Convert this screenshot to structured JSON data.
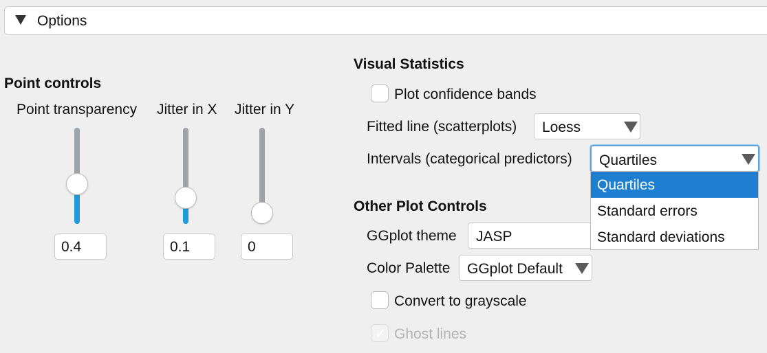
{
  "options": {
    "label": "Options"
  },
  "point_controls": {
    "title": "Point controls",
    "sliders": [
      {
        "label": "Point transparency",
        "value": "0.4"
      },
      {
        "label": "Jitter in X",
        "value": "0.1"
      },
      {
        "label": "Jitter in Y",
        "value": "0"
      }
    ]
  },
  "visual_statistics": {
    "title": "Visual Statistics",
    "confidence_bands": {
      "label": "Plot confidence bands",
      "checked": false
    },
    "fitted_line": {
      "label": "Fitted line (scatterplots)",
      "value": "Loess"
    },
    "intervals": {
      "label": "Intervals (categorical predictors)",
      "value": "Quartiles",
      "options": [
        "Quartiles",
        "Standard errors",
        "Standard deviations"
      ],
      "selected_index": 0
    }
  },
  "other_plot_controls": {
    "title": "Other Plot Controls",
    "ggplot_theme": {
      "label": "GGplot theme",
      "value": "JASP"
    },
    "color_palette": {
      "label": "Color Palette",
      "value": "GGplot Default"
    },
    "grayscale": {
      "label": "Convert to grayscale",
      "checked": false
    },
    "ghost_lines": {
      "label": "Ghost lines",
      "checked": true,
      "disabled": true
    }
  },
  "colors": {
    "accent": "#1f9bd9",
    "selection": "#1e7fd0",
    "focus_border": "#5aa4e0"
  }
}
